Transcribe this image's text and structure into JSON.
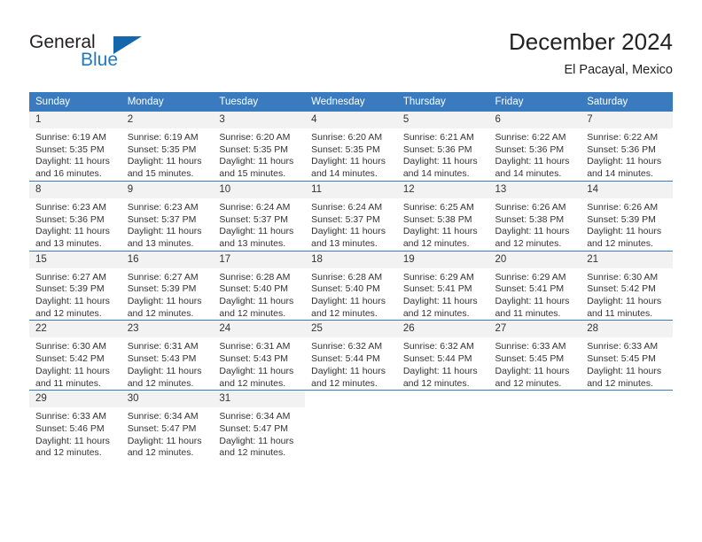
{
  "brand": {
    "name_part1": "General",
    "name_part2": "Blue",
    "mark": "triangle-logo-mark",
    "accent_color": "#1566ab"
  },
  "header": {
    "title": "December 2024",
    "subtitle": "El Pacayal, Mexico"
  },
  "theme": {
    "header_row_bg": "#3a7bbf",
    "daynum_bg": "#f2f2f2",
    "text_color": "#333333"
  },
  "weekdays": [
    "Sunday",
    "Monday",
    "Tuesday",
    "Wednesday",
    "Thursday",
    "Friday",
    "Saturday"
  ],
  "chart_data": {
    "type": "table",
    "title": "December 2024",
    "subtitle": "El Pacayal, Mexico",
    "columns": [
      "Sunday",
      "Monday",
      "Tuesday",
      "Wednesday",
      "Thursday",
      "Friday",
      "Saturday"
    ],
    "rows": [
      [
        {
          "day": "1",
          "sunrise": "Sunrise: 6:19 AM",
          "sunset": "Sunset: 5:35 PM",
          "daylight1": "Daylight: 11 hours",
          "daylight2": "and 16 minutes."
        },
        {
          "day": "2",
          "sunrise": "Sunrise: 6:19 AM",
          "sunset": "Sunset: 5:35 PM",
          "daylight1": "Daylight: 11 hours",
          "daylight2": "and 15 minutes."
        },
        {
          "day": "3",
          "sunrise": "Sunrise: 6:20 AM",
          "sunset": "Sunset: 5:35 PM",
          "daylight1": "Daylight: 11 hours",
          "daylight2": "and 15 minutes."
        },
        {
          "day": "4",
          "sunrise": "Sunrise: 6:20 AM",
          "sunset": "Sunset: 5:35 PM",
          "daylight1": "Daylight: 11 hours",
          "daylight2": "and 14 minutes."
        },
        {
          "day": "5",
          "sunrise": "Sunrise: 6:21 AM",
          "sunset": "Sunset: 5:36 PM",
          "daylight1": "Daylight: 11 hours",
          "daylight2": "and 14 minutes."
        },
        {
          "day": "6",
          "sunrise": "Sunrise: 6:22 AM",
          "sunset": "Sunset: 5:36 PM",
          "daylight1": "Daylight: 11 hours",
          "daylight2": "and 14 minutes."
        },
        {
          "day": "7",
          "sunrise": "Sunrise: 6:22 AM",
          "sunset": "Sunset: 5:36 PM",
          "daylight1": "Daylight: 11 hours",
          "daylight2": "and 14 minutes."
        }
      ],
      [
        {
          "day": "8",
          "sunrise": "Sunrise: 6:23 AM",
          "sunset": "Sunset: 5:36 PM",
          "daylight1": "Daylight: 11 hours",
          "daylight2": "and 13 minutes."
        },
        {
          "day": "9",
          "sunrise": "Sunrise: 6:23 AM",
          "sunset": "Sunset: 5:37 PM",
          "daylight1": "Daylight: 11 hours",
          "daylight2": "and 13 minutes."
        },
        {
          "day": "10",
          "sunrise": "Sunrise: 6:24 AM",
          "sunset": "Sunset: 5:37 PM",
          "daylight1": "Daylight: 11 hours",
          "daylight2": "and 13 minutes."
        },
        {
          "day": "11",
          "sunrise": "Sunrise: 6:24 AM",
          "sunset": "Sunset: 5:37 PM",
          "daylight1": "Daylight: 11 hours",
          "daylight2": "and 13 minutes."
        },
        {
          "day": "12",
          "sunrise": "Sunrise: 6:25 AM",
          "sunset": "Sunset: 5:38 PM",
          "daylight1": "Daylight: 11 hours",
          "daylight2": "and 12 minutes."
        },
        {
          "day": "13",
          "sunrise": "Sunrise: 6:26 AM",
          "sunset": "Sunset: 5:38 PM",
          "daylight1": "Daylight: 11 hours",
          "daylight2": "and 12 minutes."
        },
        {
          "day": "14",
          "sunrise": "Sunrise: 6:26 AM",
          "sunset": "Sunset: 5:39 PM",
          "daylight1": "Daylight: 11 hours",
          "daylight2": "and 12 minutes."
        }
      ],
      [
        {
          "day": "15",
          "sunrise": "Sunrise: 6:27 AM",
          "sunset": "Sunset: 5:39 PM",
          "daylight1": "Daylight: 11 hours",
          "daylight2": "and 12 minutes."
        },
        {
          "day": "16",
          "sunrise": "Sunrise: 6:27 AM",
          "sunset": "Sunset: 5:39 PM",
          "daylight1": "Daylight: 11 hours",
          "daylight2": "and 12 minutes."
        },
        {
          "day": "17",
          "sunrise": "Sunrise: 6:28 AM",
          "sunset": "Sunset: 5:40 PM",
          "daylight1": "Daylight: 11 hours",
          "daylight2": "and 12 minutes."
        },
        {
          "day": "18",
          "sunrise": "Sunrise: 6:28 AM",
          "sunset": "Sunset: 5:40 PM",
          "daylight1": "Daylight: 11 hours",
          "daylight2": "and 12 minutes."
        },
        {
          "day": "19",
          "sunrise": "Sunrise: 6:29 AM",
          "sunset": "Sunset: 5:41 PM",
          "daylight1": "Daylight: 11 hours",
          "daylight2": "and 12 minutes."
        },
        {
          "day": "20",
          "sunrise": "Sunrise: 6:29 AM",
          "sunset": "Sunset: 5:41 PM",
          "daylight1": "Daylight: 11 hours",
          "daylight2": "and 11 minutes."
        },
        {
          "day": "21",
          "sunrise": "Sunrise: 6:30 AM",
          "sunset": "Sunset: 5:42 PM",
          "daylight1": "Daylight: 11 hours",
          "daylight2": "and 11 minutes."
        }
      ],
      [
        {
          "day": "22",
          "sunrise": "Sunrise: 6:30 AM",
          "sunset": "Sunset: 5:42 PM",
          "daylight1": "Daylight: 11 hours",
          "daylight2": "and 11 minutes."
        },
        {
          "day": "23",
          "sunrise": "Sunrise: 6:31 AM",
          "sunset": "Sunset: 5:43 PM",
          "daylight1": "Daylight: 11 hours",
          "daylight2": "and 12 minutes."
        },
        {
          "day": "24",
          "sunrise": "Sunrise: 6:31 AM",
          "sunset": "Sunset: 5:43 PM",
          "daylight1": "Daylight: 11 hours",
          "daylight2": "and 12 minutes."
        },
        {
          "day": "25",
          "sunrise": "Sunrise: 6:32 AM",
          "sunset": "Sunset: 5:44 PM",
          "daylight1": "Daylight: 11 hours",
          "daylight2": "and 12 minutes."
        },
        {
          "day": "26",
          "sunrise": "Sunrise: 6:32 AM",
          "sunset": "Sunset: 5:44 PM",
          "daylight1": "Daylight: 11 hours",
          "daylight2": "and 12 minutes."
        },
        {
          "day": "27",
          "sunrise": "Sunrise: 6:33 AM",
          "sunset": "Sunset: 5:45 PM",
          "daylight1": "Daylight: 11 hours",
          "daylight2": "and 12 minutes."
        },
        {
          "day": "28",
          "sunrise": "Sunrise: 6:33 AM",
          "sunset": "Sunset: 5:45 PM",
          "daylight1": "Daylight: 11 hours",
          "daylight2": "and 12 minutes."
        }
      ],
      [
        {
          "day": "29",
          "sunrise": "Sunrise: 6:33 AM",
          "sunset": "Sunset: 5:46 PM",
          "daylight1": "Daylight: 11 hours",
          "daylight2": "and 12 minutes."
        },
        {
          "day": "30",
          "sunrise": "Sunrise: 6:34 AM",
          "sunset": "Sunset: 5:47 PM",
          "daylight1": "Daylight: 11 hours",
          "daylight2": "and 12 minutes."
        },
        {
          "day": "31",
          "sunrise": "Sunrise: 6:34 AM",
          "sunset": "Sunset: 5:47 PM",
          "daylight1": "Daylight: 11 hours",
          "daylight2": "and 12 minutes."
        },
        {
          "day": "",
          "sunrise": "",
          "sunset": "",
          "daylight1": "",
          "daylight2": ""
        },
        {
          "day": "",
          "sunrise": "",
          "sunset": "",
          "daylight1": "",
          "daylight2": ""
        },
        {
          "day": "",
          "sunrise": "",
          "sunset": "",
          "daylight1": "",
          "daylight2": ""
        },
        {
          "day": "",
          "sunrise": "",
          "sunset": "",
          "daylight1": "",
          "daylight2": ""
        }
      ]
    ]
  }
}
